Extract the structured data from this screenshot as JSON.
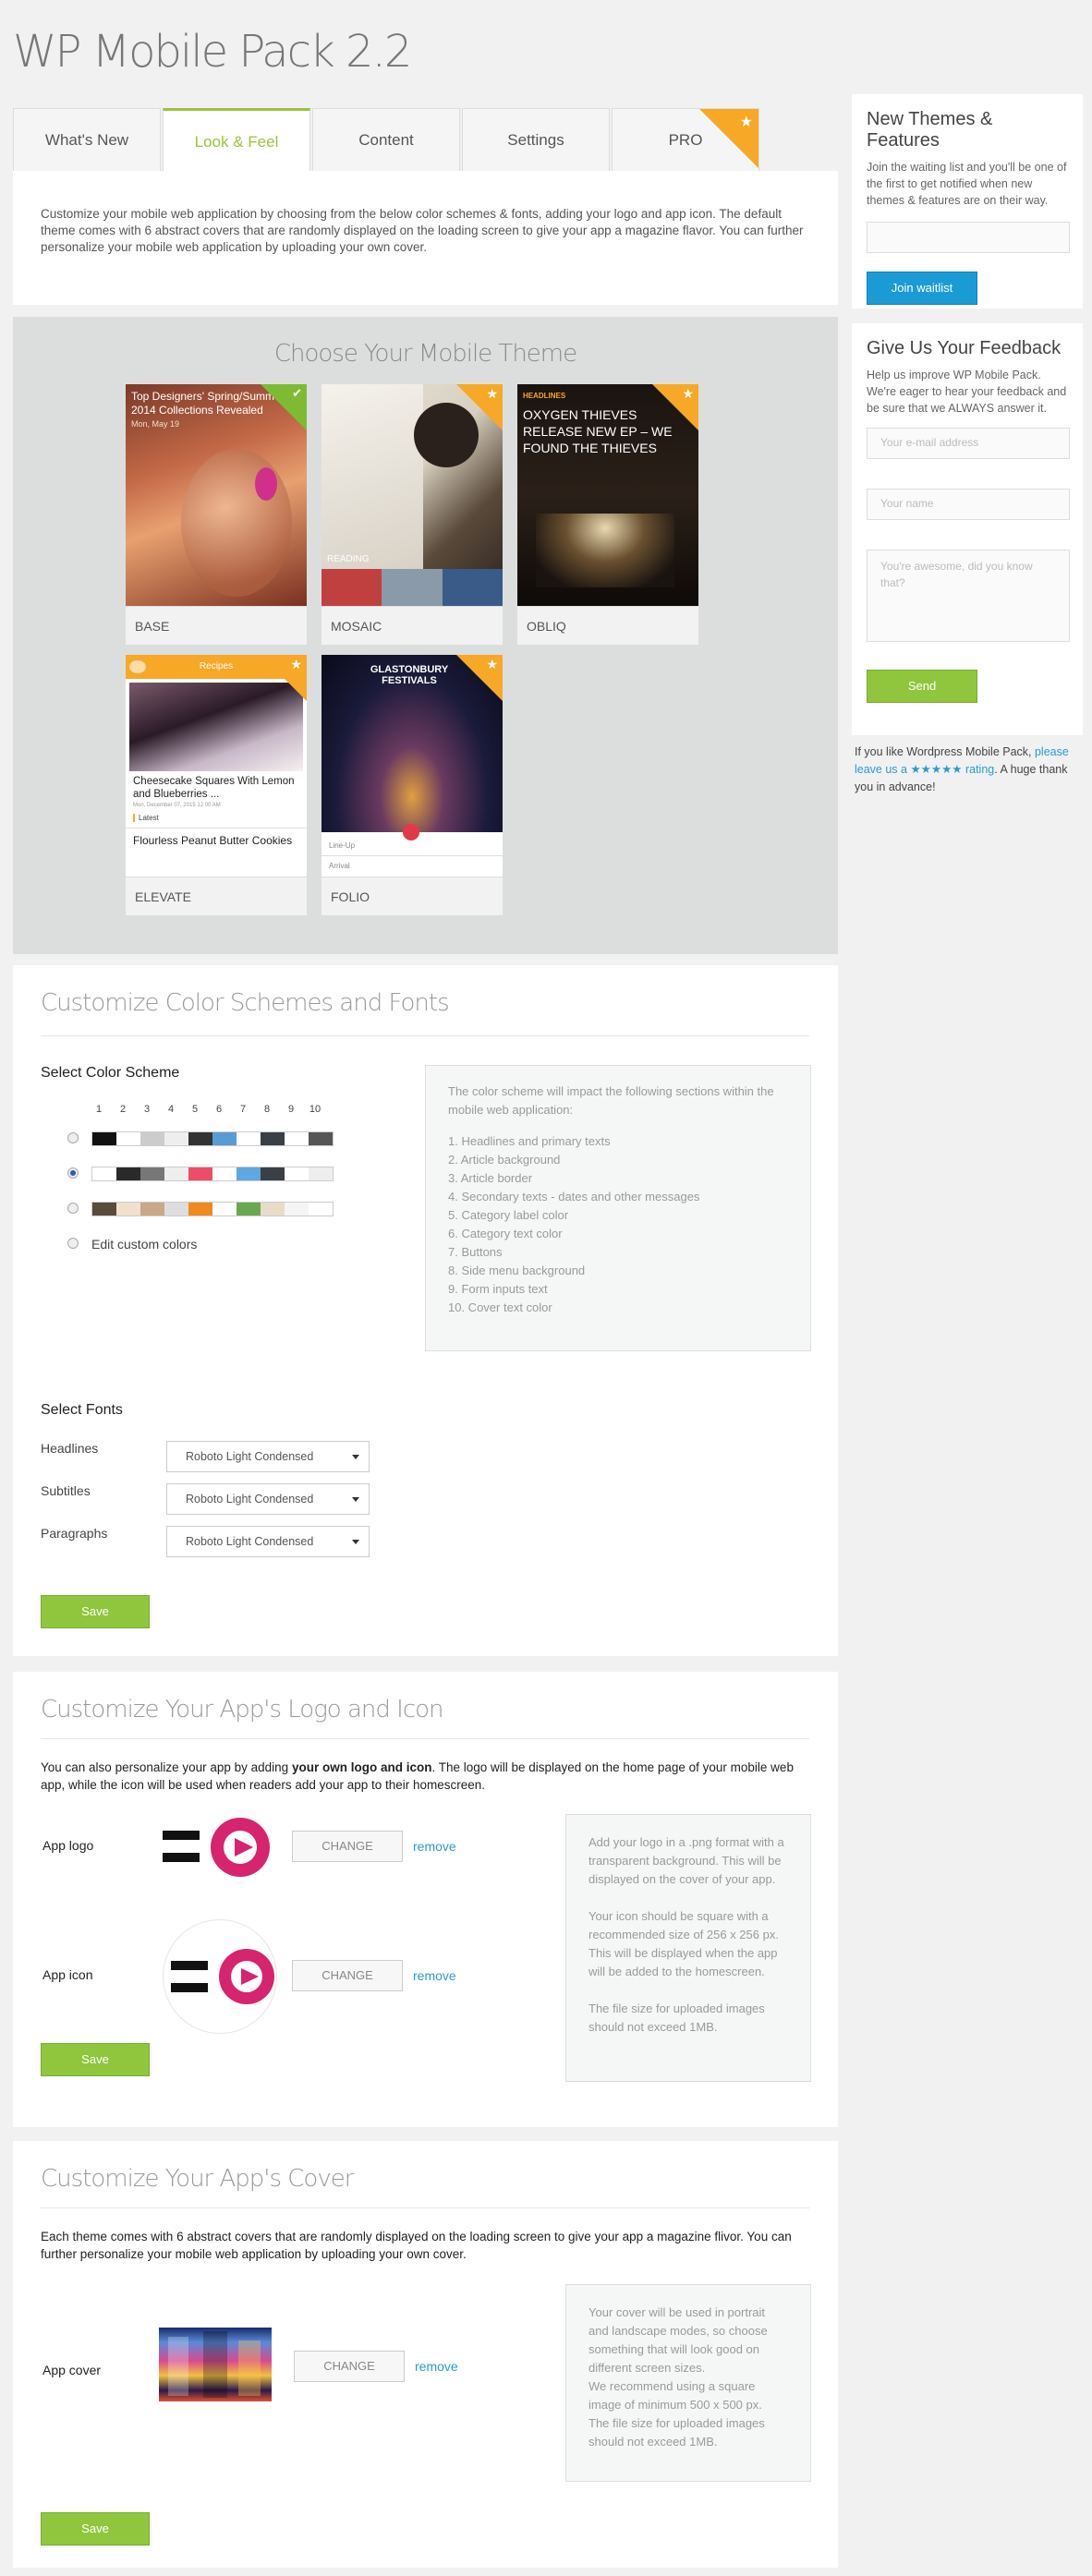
{
  "page": {
    "title": "WP Mobile Pack 2.2"
  },
  "tabs": [
    {
      "label": "What's New"
    },
    {
      "label": "Look & Feel"
    },
    {
      "label": "Content"
    },
    {
      "label": "Settings"
    },
    {
      "label": "PRO"
    }
  ],
  "intro": {
    "text": "Customize your mobile web application by choosing from the below color schemes & fonts, adding your logo and app icon. The default theme comes with 6 abstract covers that are randomly displayed on the loading screen to give your app a magazine flavor. You can further personalize your mobile web application by uploading your own cover."
  },
  "themes": {
    "heading": "Choose Your Mobile Theme",
    "items": [
      {
        "name": "BASE",
        "overlay_title": "Top Designers' Spring/Summer 2014 Collections Revealed",
        "overlay_meta": "Mon, May 19"
      },
      {
        "name": "MOSAIC",
        "overlay_label": "READING"
      },
      {
        "name": "OBLIQ",
        "overlay_tag": "HEADLINES",
        "overlay_title": "OXYGEN THIEVES RELEASE NEW EP – WE FOUND THE THIEVES"
      },
      {
        "name": "ELEVATE",
        "header_label": "Recipes",
        "post_title": "Cheesecake Squares With Lemon and Blueberries ...",
        "post_meta": "Mon, December 07, 2015 12:00 AM",
        "latest_label": "Latest",
        "second_title": "Flourless Peanut Butter Cookies"
      },
      {
        "name": "FOLIO",
        "poster_text": "GLASTONBURY FESTIVALS",
        "row1": "Line-Up",
        "row2": "Arrival"
      }
    ]
  },
  "colors": {
    "section_title": "Customize Color Schemes and Fonts",
    "select_label": "Select Color Scheme",
    "column_numbers": [
      "1",
      "2",
      "3",
      "4",
      "5",
      "6",
      "7",
      "8",
      "9",
      "10"
    ],
    "schemes": [
      [
        "#111111",
        "#ffffff",
        "#cccccc",
        "#eeeeee",
        "#333333",
        "#5b9bd5",
        "#ffffff",
        "#3a4045",
        "#ffffff",
        "#555555"
      ],
      [
        "#ffffff",
        "#2a2a2a",
        "#777777",
        "#eeeeee",
        "#ee4d65",
        "#ffffff",
        "#5da8e0",
        "#3a4045",
        "#ffffff",
        "#eeeeee"
      ],
      [
        "#5a4a3a",
        "#f0e0cc",
        "#c8a888",
        "#dddddd",
        "#f08a20",
        "#ffffff",
        "#6aa84f",
        "#e8dcc8",
        "#f5f5f5",
        "#ffffff"
      ]
    ],
    "selected_index": 1,
    "custom_label": "Edit custom colors",
    "info_intro": "The color scheme will impact the following sections within the mobile web application:",
    "info_items": [
      "1. Headlines and primary texts",
      "2. Article background",
      "3. Article border",
      "4. Secondary texts - dates and other messages",
      "5. Category label color",
      "6. Category text color",
      "7. Buttons",
      "8. Side menu background",
      "9. Form inputs text",
      "10. Cover text color"
    ],
    "fonts_label": "Select Fonts",
    "fonts": [
      {
        "label": "Headlines",
        "value": "Roboto Light Condensed"
      },
      {
        "label": "Subtitles",
        "value": "Roboto Light Condensed"
      },
      {
        "label": "Paragraphs",
        "value": "Roboto Light Condensed"
      }
    ],
    "save_label": "Save"
  },
  "logo": {
    "section_title": "Customize Your App's Logo and Icon",
    "desc_before": "You can also personalize your app by adding ",
    "desc_bold": "your own logo and icon",
    "desc_after": ". The logo will be displayed on the home page of your mobile web app, while the icon will be used when readers add your app to their homescreen.",
    "app_logo_label": "App logo",
    "app_icon_label": "App icon",
    "change_label": "CHANGE",
    "remove_label": "remove",
    "info_p1": "Add your logo in a .png format with a transparent background. This will be displayed on the cover of your app.",
    "info_p2": "Your icon should be square with a recommended size of 256 x 256 px. This will be displayed when the app will be added to the homescreen.",
    "info_p3": "The file size for uploaded images should not exceed 1MB.",
    "save_label": "Save"
  },
  "cover": {
    "section_title": "Customize Your App's Cover",
    "desc": "Each theme comes with 6 abstract covers that are randomly displayed on the loading screen to give your app a magazine flivor. You can further personalize your mobile web application by uploading your own cover.",
    "app_cover_label": "App cover",
    "change_label": "CHANGE",
    "remove_label": "remove",
    "info_p1": "Your cover will be used in portrait and landscape modes, so choose something that will look good on different screen sizes.",
    "info_p2": "We recommend using a square image of minimum 500 x 500 px.",
    "info_p3": "The file size for uploaded images should not exceed 1MB.",
    "save_label": "Save"
  },
  "sidebar": {
    "waitlist_title": "New Themes & Features",
    "waitlist_text": "Join the waiting list and you'll be one of the first to get notified when new themes & features are on their way.",
    "waitlist_button": "Join waitlist",
    "feedback_title": "Give Us Your Feedback",
    "feedback_text": "Help us improve WP Mobile Pack. We're eager to hear your feedback and be sure that we ALWAYS answer it.",
    "email_placeholder": "Your e-mail address",
    "name_placeholder": "Your name",
    "message_placeholder": "You're awesome, did you know that?",
    "send_label": "Send",
    "rating_before": "If you like Wordpress Mobile Pack, ",
    "rating_link": "please leave us a ★★★★★ rating",
    "rating_after": ". A huge thank you in advance!"
  }
}
